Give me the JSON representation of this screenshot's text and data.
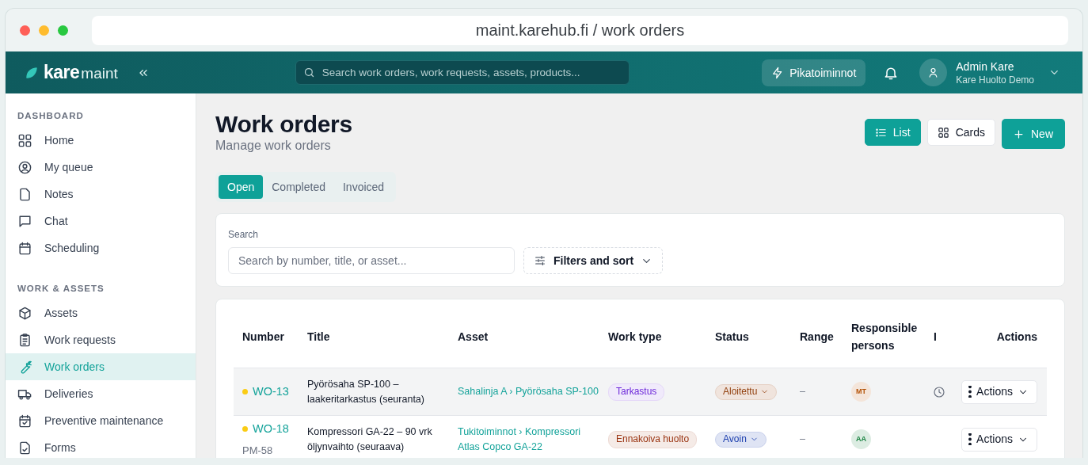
{
  "browser": {
    "url": "maint.karehub.fi / work orders"
  },
  "header": {
    "logo": {
      "brand": "kare",
      "product": "maint"
    },
    "search_placeholder": "Search work orders, work requests, assets, products...",
    "quick_actions": "Pikatoiminnot",
    "user": {
      "name": "Admin Kare",
      "organization": "Kare Huolto Demo"
    }
  },
  "sidebar": {
    "sections": [
      {
        "title": "DASHBOARD",
        "items": [
          {
            "label": "Home",
            "selected": false
          },
          {
            "label": "My queue",
            "selected": false
          },
          {
            "label": "Notes",
            "selected": false
          },
          {
            "label": "Chat",
            "selected": false
          },
          {
            "label": "Scheduling",
            "selected": false
          }
        ]
      },
      {
        "title": "WORK & ASSETS",
        "items": [
          {
            "label": "Assets",
            "selected": false
          },
          {
            "label": "Work requests",
            "selected": false
          },
          {
            "label": "Work orders",
            "selected": true
          },
          {
            "label": "Deliveries",
            "selected": false
          },
          {
            "label": "Preventive maintenance",
            "selected": false
          },
          {
            "label": "Forms",
            "selected": false
          }
        ]
      }
    ]
  },
  "page": {
    "title": "Work orders",
    "subtitle": "Manage work orders",
    "view_buttons": [
      {
        "label": "List",
        "selected": true
      },
      {
        "label": "Cards",
        "selected": false
      }
    ],
    "new_button": "New",
    "tabs": [
      {
        "label": "Open",
        "selected": true
      },
      {
        "label": "Completed",
        "selected": false
      },
      {
        "label": "Invoiced",
        "selected": false
      }
    ],
    "search": {
      "label": "Search",
      "placeholder": "Search by number, title, or asset...",
      "filter_button": "Filters and sort"
    },
    "table": {
      "columns": [
        "Number",
        "Title",
        "Asset",
        "Work type",
        "Status",
        "Range",
        "Responsible persons",
        "I",
        "Actions"
      ],
      "rows": [
        {
          "number": "WO-13",
          "priority_dot": {
            "color": "#facc15"
          },
          "title": "Pyörösaha SP-100 – laakeritarkastus (seuranta)",
          "asset": "Sahalinja A › Pyörösaha SP-100",
          "work_type": {
            "label": "Tarkastus",
            "color": "#6d28d9"
          },
          "status": {
            "label": "Aloitettu",
            "color": "#92400e"
          },
          "range": "–",
          "responsible": [
            {
              "initials": "MT",
              "color": "#b45309"
            }
          ],
          "timer": true,
          "hovered": true,
          "action": "Actions"
        },
        {
          "number": "WO-18",
          "sub_number": "PM-58",
          "priority_dot": {
            "color": "#facc15"
          },
          "title": "Kompressori GA-22 – 90 vrk öljynvaihto (seuraava)",
          "asset": "Tukitoiminnot › Kompressori Atlas Copco GA-22",
          "work_type": {
            "label": "Ennakoiva huolto",
            "color": "#9a3412"
          },
          "status": {
            "label": "Avoin",
            "color": "#1e40af"
          },
          "range": "–",
          "responsible": [
            {
              "initials": "AA",
              "color": "#15803d"
            }
          ],
          "timer": false,
          "hovered": false,
          "action": "Actions"
        }
      ]
    }
  }
}
